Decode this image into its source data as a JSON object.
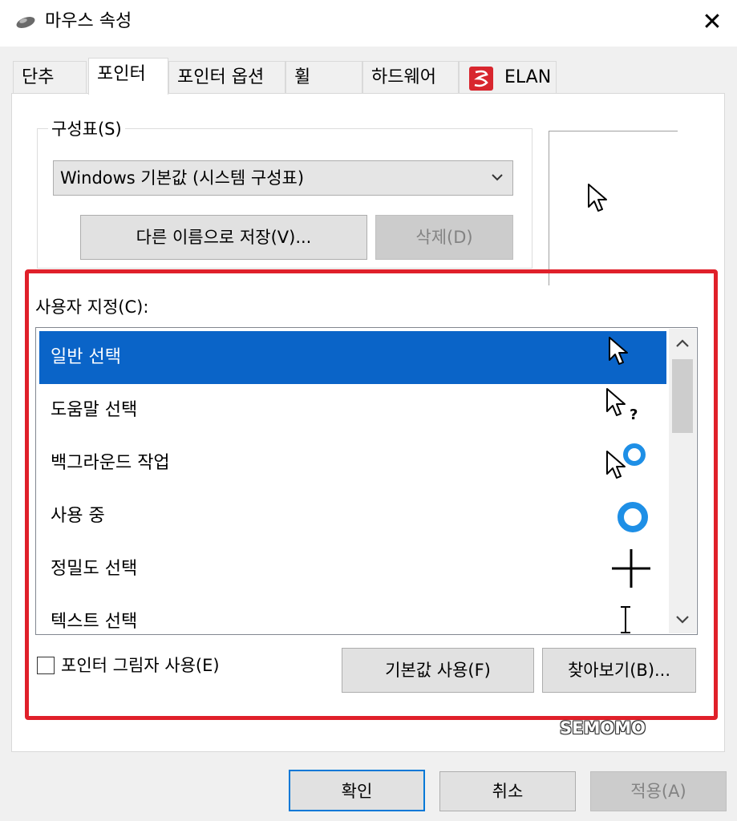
{
  "window": {
    "title": "마우스 속성",
    "close_glyph": "✕",
    "app_icon": "mouse-icon"
  },
  "tabs": [
    {
      "label": "단추"
    },
    {
      "label": "포인터"
    },
    {
      "label": "포인터 옵션"
    },
    {
      "label": "휠"
    },
    {
      "label": "하드웨어"
    },
    {
      "label": "ELAN",
      "icon": "elan-logo-icon"
    }
  ],
  "active_tab": "포인터",
  "scheme": {
    "label": "구성표(S)",
    "selected": "Windows 기본값 (시스템 구성표)",
    "save_as_label": "다른 이름으로 저장(V)...",
    "delete_label": "삭제(D)"
  },
  "customize": {
    "label": "사용자 지정(C):",
    "items": [
      {
        "label": "일반 선택",
        "cursor": "arrow-cursor-icon",
        "selected": true
      },
      {
        "label": "도움말 선택",
        "cursor": "help-cursor-icon",
        "selected": false
      },
      {
        "label": "백그라운드 작업",
        "cursor": "working-in-background-cursor-icon",
        "selected": false
      },
      {
        "label": "사용 중",
        "cursor": "busy-cursor-icon",
        "selected": false
      },
      {
        "label": "정밀도 선택",
        "cursor": "crosshair-cursor-icon",
        "selected": false
      },
      {
        "label": "텍스트 선택",
        "cursor": "text-select-cursor-icon",
        "selected": false
      }
    ]
  },
  "shadow": {
    "label": "포인터 그림자 사용(E)",
    "checked": false
  },
  "default_button": "기본값 사용(F)",
  "browse_button": "찾아보기(B)...",
  "watermark": "SEMOMO",
  "footer": {
    "ok": "확인",
    "cancel": "취소",
    "apply": "적용(A)"
  },
  "colors": {
    "selection": "#0a64c8",
    "highlight_border": "#e0202a",
    "ok_border": "#0078d7"
  }
}
